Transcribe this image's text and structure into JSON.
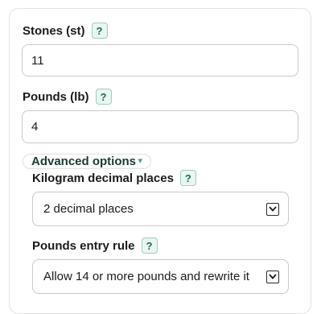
{
  "stones": {
    "label": "Stones (st)",
    "help": "?",
    "value": "11"
  },
  "pounds": {
    "label": "Pounds (lb)",
    "help": "?",
    "value": "4"
  },
  "advanced": {
    "toggle_label": "Advanced options"
  },
  "kg_decimals": {
    "label": "Kilogram decimal places",
    "help": "?",
    "selected": "2 decimal places"
  },
  "pounds_rule": {
    "label": "Pounds entry rule",
    "help": "?",
    "selected": "Allow 14 or more pounds and rewrite it"
  },
  "icons": {
    "help": "help-icon",
    "dropdown": "chevron-down-icon",
    "toggle": "expand-arrow-icon"
  }
}
